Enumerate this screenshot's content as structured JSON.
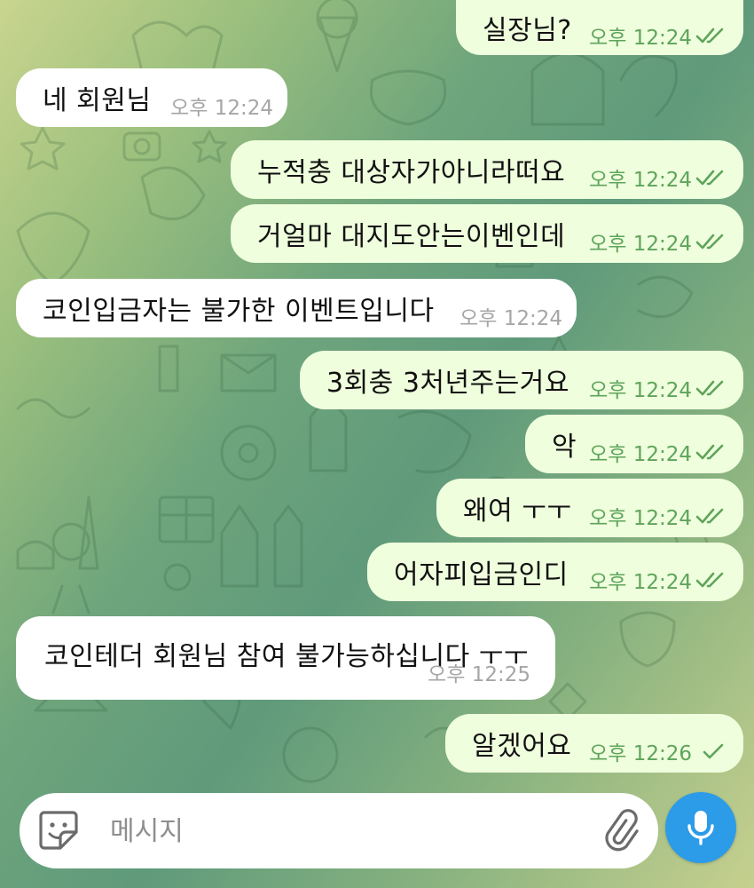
{
  "colors": {
    "outgoing_bubble": "#effedd",
    "incoming_bubble": "#ffffff",
    "outgoing_meta": "#5ea45b",
    "incoming_meta": "#a6a6a6",
    "mic_button": "#2c9be8"
  },
  "messages": [
    {
      "dir": "out",
      "text": "실장님?",
      "time": "오후 12:24",
      "status": "read"
    },
    {
      "dir": "in",
      "text": "네 회원님",
      "time": "오후 12:24"
    },
    {
      "dir": "out",
      "text": "누적충 대상자가아니라떠요",
      "time": "오후 12:24",
      "status": "read"
    },
    {
      "dir": "out",
      "text": "거얼마 대지도안는이벤인데",
      "time": "오후 12:24",
      "status": "read"
    },
    {
      "dir": "in",
      "text": "코인입금자는 불가한 이벤트입니다",
      "time": "오후 12:24"
    },
    {
      "dir": "out",
      "text": "3회충 3처년주는거요",
      "time": "오후 12:24",
      "status": "read"
    },
    {
      "dir": "out",
      "text": "악",
      "time": "오후 12:24",
      "status": "read"
    },
    {
      "dir": "out",
      "text": "왜여 ㅜㅜ",
      "time": "오후 12:24",
      "status": "read"
    },
    {
      "dir": "out",
      "text": "어자피입금인디",
      "time": "오후 12:24",
      "status": "read"
    },
    {
      "dir": "in",
      "text": "코인테더 회원님 참여 불가능하십니다 ㅜㅜ",
      "time": "오후 12:25"
    },
    {
      "dir": "out",
      "text": "알겠어요",
      "time": "오후 12:26",
      "status": "sent"
    }
  ],
  "composer": {
    "placeholder": "메시지",
    "icons": {
      "emoji": "sticker-emoji-icon",
      "attach": "paperclip-icon",
      "mic": "microphone-icon"
    }
  }
}
